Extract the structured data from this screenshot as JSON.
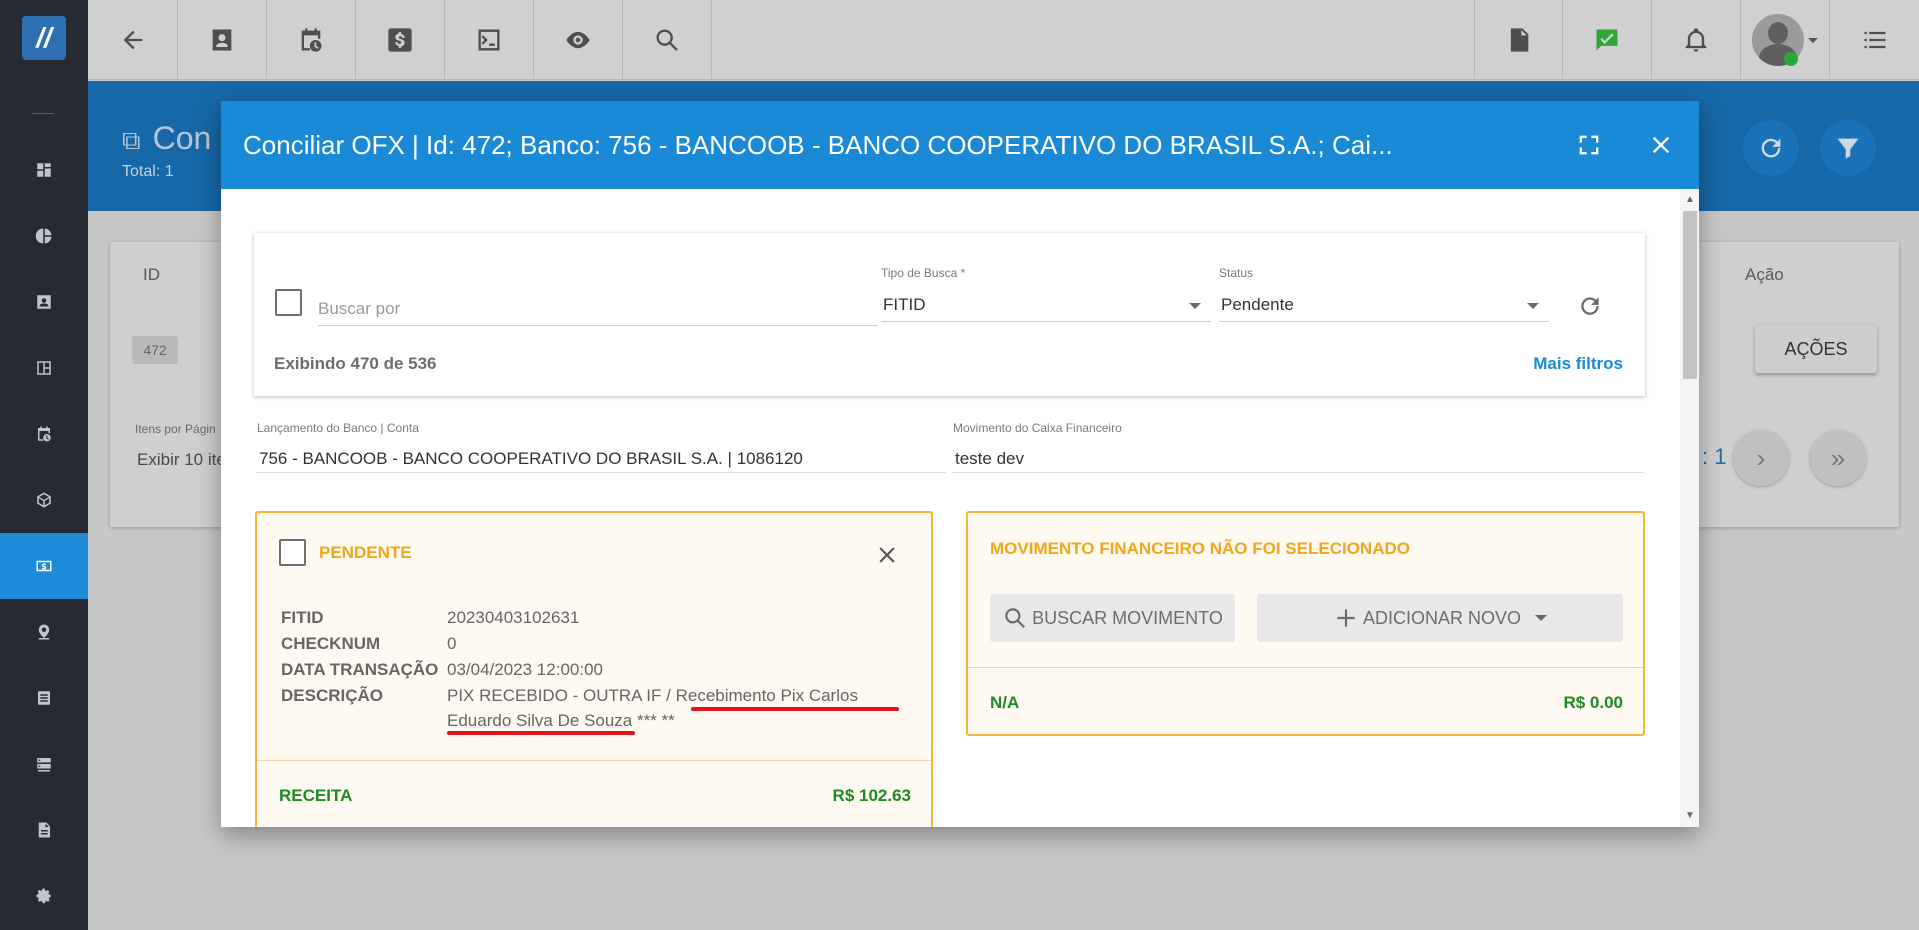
{
  "sidebar": {
    "logo_label": "logo",
    "items": [
      {
        "icon": "dashboard-icon"
      },
      {
        "icon": "pie-chart-icon"
      },
      {
        "icon": "contact-card-icon"
      },
      {
        "icon": "board-icon"
      },
      {
        "icon": "calendar-clock-icon"
      },
      {
        "icon": "package-icon"
      },
      {
        "icon": "money-icon",
        "active": true
      },
      {
        "icon": "location-icon"
      },
      {
        "icon": "document-list-icon"
      },
      {
        "icon": "server-icon"
      },
      {
        "icon": "file-icon"
      },
      {
        "icon": "gear-icon"
      }
    ]
  },
  "topbar": {
    "icons": [
      "back-arrow-icon",
      "contact-icon",
      "calendar-clock-icon",
      "dollar-icon",
      "terminal-icon",
      "eye-icon",
      "search-icon",
      "pdf-icon",
      "check-chat-icon",
      "bell-icon",
      "avatar",
      "menu-list-icon"
    ]
  },
  "page": {
    "title": "Con",
    "total": "Total: 1",
    "table": {
      "col_id": "ID",
      "col_acao": "Ação",
      "row_id": "472",
      "acoes_button": "AÇÕES"
    },
    "pagination": {
      "itens_label": "Itens por Págin",
      "itens_value": "Exibir 10 ite",
      "page_fragment": ": 1"
    }
  },
  "modal": {
    "title": "Conciliar OFX | Id: 472; Banco: 756 - BANCOOB - BANCO COOPERATIVO DO BRASIL S.A.; Cai...",
    "filter": {
      "search_placeholder": "Buscar por",
      "search_value": "",
      "tipo_busca_label": "Tipo de Busca *",
      "tipo_busca_value": "FITID",
      "status_label": "Status",
      "status_value": "Pendente",
      "exibindo": "Exibindo 470 de 536",
      "mais_filtros": "Mais filtros"
    },
    "lancamento": {
      "label": "Lançamento do Banco | Conta",
      "value": "756 - BANCOOB - BANCO COOPERATIVO DO BRASIL S.A. | 1086120"
    },
    "movimento_caixa": {
      "label": "Movimento do Caixa Financeiro",
      "value": "teste dev"
    },
    "transaction": {
      "status": "PENDENTE",
      "fields": [
        {
          "key": "FITID",
          "value": "20230403102631"
        },
        {
          "key": "CHECKNUM",
          "value": "0"
        },
        {
          "key": "DATA TRANSAÇÃO",
          "value": "03/04/2023 12:00:00"
        },
        {
          "key": "DESCRIÇÃO",
          "value": "PIX RECEBIDO - OUTRA IF / Recebimento Pix Carlos Eduardo Silva De Souza ***              **"
        }
      ],
      "type": "RECEITA",
      "amount": "R$ 102.63"
    },
    "movement": {
      "title": "MOVIMENTO FINANCEIRO NÃO FOI SELECIONADO",
      "buscar_button": "BUSCAR MOVIMENTO",
      "adicionar_button": "ADICIONAR NOVO",
      "na": "N/A",
      "total": "R$ 0.00"
    }
  },
  "colors": {
    "primary": "#1a8ad6",
    "warning": "#f6b534",
    "success": "#1e8a23",
    "sidebar": "#252a33",
    "annotation_red": "#e4141b"
  }
}
